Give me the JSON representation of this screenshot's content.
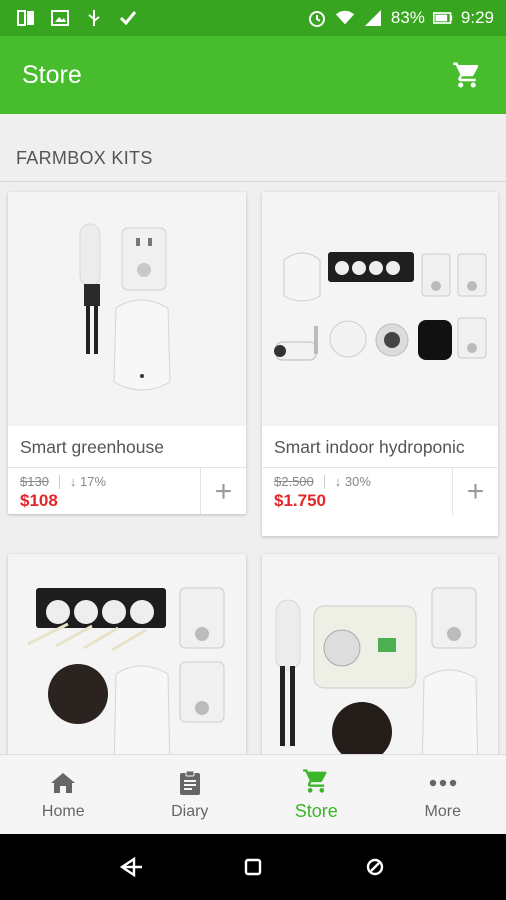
{
  "status_bar": {
    "battery": "83%",
    "time": "9:29"
  },
  "app_bar": {
    "title": "Store"
  },
  "section": {
    "title": "FARMBOX KITS"
  },
  "products": [
    {
      "title": "Smart greenhouse",
      "old_price": "$130",
      "discount": "↓ 17%",
      "price": "$108",
      "add_label": "+"
    },
    {
      "title": "Smart indoor hydroponic",
      "old_price": "$2.500",
      "discount": "↓ 30%",
      "price": "$1.750",
      "add_label": "+"
    }
  ],
  "bottom_nav": [
    {
      "label": "Home"
    },
    {
      "label": "Diary"
    },
    {
      "label": "Store"
    },
    {
      "label": "More"
    }
  ],
  "colors": {
    "primary": "#47bd2d",
    "status_bar": "#37a51f",
    "price": "#e3262a",
    "active_tab": "#3db52a"
  }
}
